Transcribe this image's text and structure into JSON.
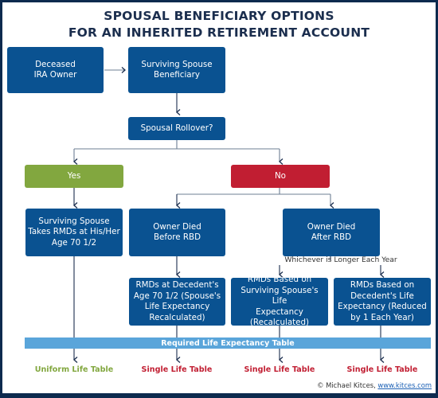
{
  "title": {
    "line1": "SPOUSAL BENEFICIARY OPTIONS",
    "line2": "FOR AN INHERITED RETIREMENT ACCOUNT"
  },
  "nodes": {
    "deceased_owner": "Deceased\nIRA Owner",
    "surviving_spouse": "Surviving Spouse\nBeneficiary",
    "spousal_rollover": "Spousal Rollover?",
    "yes": "Yes",
    "no": "No",
    "spouse_takes_rmds": "Surviving Spouse\nTakes RMDs at His/Her\nAge 70 1/2",
    "died_before_rbd": "Owner Died\nBefore RBD",
    "died_after_rbd": "Owner Died\nAfter RBD",
    "rmds_decedent_age": "RMDs at Decedent's\nAge 70 1/2 (Spouse's\nLife Expectancy\nRecalculated)",
    "rmds_spouse_le": "RMDs Based on\nSurviving Spouse's Life\nExpectancy\n(Recalculated)",
    "rmds_decedent_le": "RMDs Based on\nDecedent's Life\nExpectancy (Reduced\nby 1 Each Year)"
  },
  "annotations": {
    "whichever": "Whichever is Longer Each Year",
    "table_bar": "Required Life Expectancy Table"
  },
  "outcomes": [
    {
      "label": "Uniform Life Table",
      "color": "#82a73f"
    },
    {
      "label": "Single Life Table",
      "color": "#c11e32"
    },
    {
      "label": "Single Life Table",
      "color": "#c11e32"
    },
    {
      "label": "Single Life Table",
      "color": "#c11e32"
    }
  ],
  "credit": {
    "text": "© Michael Kitces, ",
    "link": "www.kitces.com"
  },
  "colors": {
    "box_blue": "#0a5291",
    "yes_green": "#82a73f",
    "no_red": "#c11e32",
    "bar_blue": "#5aa5da",
    "frame_navy": "#0d2a4e"
  }
}
